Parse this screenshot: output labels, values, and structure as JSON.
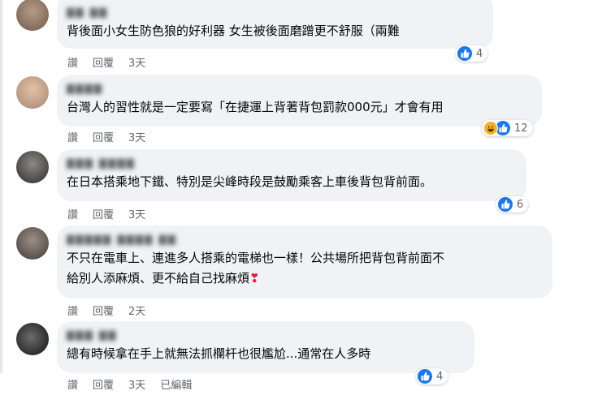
{
  "colors": {
    "like": "#1877f2",
    "haha": "#f7b125",
    "bubble": "#f0f2f5",
    "meta": "#65676b",
    "heart": "#e41e3f"
  },
  "action_labels": {
    "like": "讚",
    "reply": "回覆"
  },
  "comments": [
    {
      "author": "▇▇ ▇▇",
      "text": "背後面小女生防色狼的好利器 女生被後面磨蹭更不舒服（兩難",
      "time": "3天",
      "reaction_icons": [
        "like-icon"
      ],
      "reaction_count": "4",
      "avatar_colors": [
        "#b69a86",
        "#6f5a4c"
      ]
    },
    {
      "author": "▇▇▇▇",
      "text": "台灣人的習性就是一定要寫「在捷運上背著背包罰款000元」才會有用",
      "time": "3天",
      "reaction_icons": [
        "haha-icon",
        "like-icon"
      ],
      "reaction_count": "12",
      "avatar_colors": [
        "#e2c1a7",
        "#a58871"
      ]
    },
    {
      "author": "▇▇▇ ▇▇▇▇",
      "text": "在日本搭乘地下鐵、特別是尖峰時段是鼓勵乘客上車後背包背前面。",
      "time": "3天",
      "reaction_icons": [
        "like-icon"
      ],
      "reaction_count": "6",
      "avatar_colors": [
        "#8d8a86",
        "#2e2b28"
      ]
    },
    {
      "author": "▇▇▇▇▇ ▇▇▇▇ ▇▇",
      "text_lines": [
        "不只在電車上、連進多人搭乘的電梯也一樣！公共場所把背包背前面不",
        "給別人添麻煩、更不給自己找麻煩"
      ],
      "heart": "❣",
      "time": "2天",
      "avatar_colors": [
        "#9b9088",
        "#433a34"
      ]
    },
    {
      "author": "▇▇▇ ▇▇",
      "text": "總有時候拿在手上就無法抓欄杆也很尷尬...通常在人多時",
      "time": "3天",
      "edited": "已編輯",
      "reaction_icons": [
        "like-icon"
      ],
      "reaction_count": "4",
      "avatar_colors": [
        "#6c6c6c",
        "#111111"
      ]
    }
  ]
}
